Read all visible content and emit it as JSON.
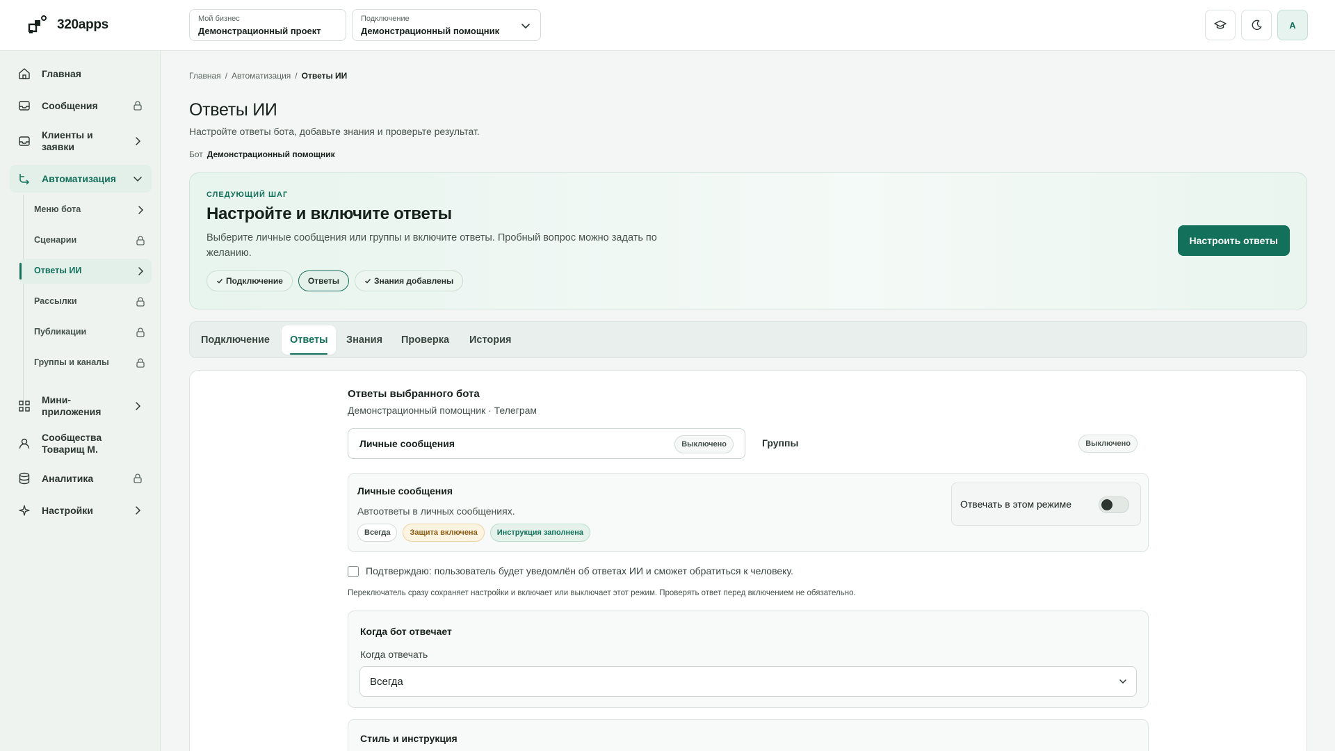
{
  "app": {
    "name": "320apps"
  },
  "header": {
    "business": {
      "label": "Мой бизнес",
      "value": "Демонстрационный проект"
    },
    "connection": {
      "label": "Подключение",
      "value": "Демонстрационный помощник"
    },
    "avatar_initial": "A"
  },
  "sidebar": {
    "items": [
      {
        "label": "Главная",
        "icon": "home-icon"
      },
      {
        "label": "Сообщения",
        "icon": "inbox-icon",
        "trail": "lock-icon"
      },
      {
        "label": "Клиенты и заявки",
        "icon": "inbox-icon",
        "trail": "chevron-right-icon"
      },
      {
        "label": "Автоматизация",
        "icon": "automation-icon",
        "trail": "chevron-down-icon"
      },
      {
        "label": "Мини-приложения",
        "icon": "apps-icon",
        "trail": "chevron-right-icon"
      },
      {
        "label": "Сообщества Товарищ М.",
        "icon": "user-icon"
      },
      {
        "label": "Аналитика",
        "icon": "database-icon",
        "trail": "lock-icon"
      },
      {
        "label": "Настройки",
        "icon": "sparkle-icon",
        "trail": "chevron-right-icon"
      }
    ],
    "sub_items": [
      {
        "label": "Меню бота",
        "trail": "chevron-right-icon"
      },
      {
        "label": "Сценарии",
        "trail": "lock-icon"
      },
      {
        "label": "Ответы ИИ",
        "trail": "chevron-right-icon"
      },
      {
        "label": "Рассылки",
        "trail": "lock-icon"
      },
      {
        "label": "Публикации",
        "trail": "lock-icon"
      },
      {
        "label": "Группы и каналы",
        "trail": "lock-icon"
      }
    ]
  },
  "breadcrumb": {
    "items": [
      "Главная",
      "Автоматизация",
      "Ответы ИИ"
    ],
    "sep": "/"
  },
  "page": {
    "title": "Ответы ИИ",
    "subtitle": "Настройте ответы бота, добавьте знания и проверьте результат.",
    "bot_label": "Бот",
    "bot_name": "Демонстрационный помощник"
  },
  "next_step": {
    "eyebrow": "СЛЕДУЮЩИЙ ШАГ",
    "title": "Настройте и включите ответы",
    "description": "Выберите личные сообщения или группы и включите ответы. Пробный вопрос можно задать по желанию.",
    "chips": [
      "Подключение",
      "Ответы",
      "Знания добавлены"
    ],
    "button": "Настроить ответы"
  },
  "tabs": [
    "Подключение",
    "Ответы",
    "Знания",
    "Проверка",
    "История"
  ],
  "answers": {
    "title": "Ответы выбранного бота",
    "subtitle": "Демонстрационный помощник · Телеграм",
    "modes": [
      {
        "label": "Личные сообщения",
        "status": "Выключено"
      },
      {
        "label": "Группы",
        "status": "Выключено"
      }
    ],
    "personal": {
      "title": "Личные сообщения",
      "description": "Автоответы в личных сообщениях.",
      "tags": [
        "Всегда",
        "Защита включена",
        "Инструкция заполнена"
      ],
      "toggle_label": "Отвечать в этом режиме",
      "toggle_on": false
    },
    "confirm": "Подтверждаю: пользователь будет уведомлён об ответах ИИ и сможет обратиться к человеку.",
    "hint": "Переключатель сразу сохраняет настройки и включает или выключает этот режим. Проверять ответ перед включением не обязательно.",
    "when": {
      "title": "Когда бот отвечает",
      "label": "Когда отвечать",
      "value": "Всегда"
    },
    "style_title": "Стиль и инструкция"
  },
  "colors": {
    "accent": "#13705a",
    "background": "#f3f6f4",
    "warning_tag": "#fdf3e1"
  }
}
